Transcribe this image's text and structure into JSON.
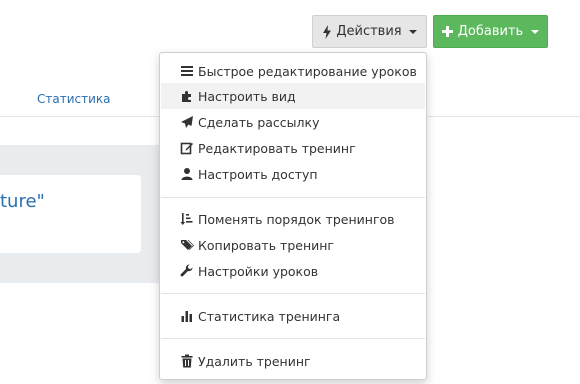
{
  "toolbar": {
    "actions_label": "Действия",
    "add_label": "Добавить"
  },
  "background": {
    "tab_statistics": "Статистика",
    "card_text_fragment": "ture\""
  },
  "menu": {
    "items": [
      {
        "label": "Быстрое редактирование уроков",
        "icon": "list-icon"
      },
      {
        "label": "Настроить вид",
        "icon": "puzzle-icon"
      },
      {
        "label": "Сделать рассылку",
        "icon": "send-icon"
      },
      {
        "label": "Редактировать тренинг",
        "icon": "edit-icon"
      },
      {
        "label": "Настроить доступ",
        "icon": "user-icon"
      },
      {
        "label": "Поменять порядок тренингов",
        "icon": "sort-icon"
      },
      {
        "label": "Копировать тренинг",
        "icon": "tags-icon"
      },
      {
        "label": "Настройки уроков",
        "icon": "wrench-icon"
      },
      {
        "label": "Статистика тренинга",
        "icon": "bar-chart-icon"
      },
      {
        "label": "Удалить тренинг",
        "icon": "trash-icon"
      }
    ]
  },
  "colors": {
    "add_button": "#5cb85c",
    "link": "#2a6fb0"
  }
}
